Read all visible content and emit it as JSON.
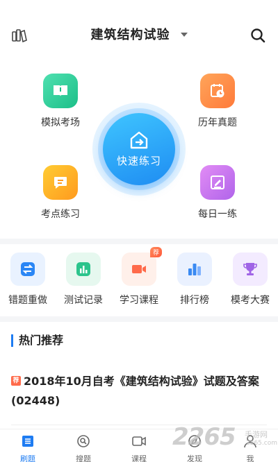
{
  "header": {
    "title": "建筑结构试验",
    "left_icon": "book-stack-icon",
    "right_icon": "search-icon"
  },
  "hub": {
    "center": {
      "label": "快速练习",
      "icon": "arrow-right-house-icon"
    },
    "items": [
      {
        "label": "模拟考场",
        "icon": "book-open-icon",
        "color": "#1cbf88"
      },
      {
        "label": "历年真题",
        "icon": "calendar-clock-icon",
        "color": "#ff7a3a"
      },
      {
        "label": "考点练习",
        "icon": "chat-lines-icon",
        "color": "#ff9a1e"
      },
      {
        "label": "每日一练",
        "icon": "pen-icon",
        "color": "#b064ea"
      }
    ]
  },
  "tools": [
    {
      "label": "错题重做",
      "icon": "swap-arrows-icon",
      "color": "#1e7cf2"
    },
    {
      "label": "测试记录",
      "icon": "bar-chart-icon",
      "color": "#1cbf88"
    },
    {
      "label": "学习课程",
      "icon": "video-camera-icon",
      "color": "#ff6a4a",
      "badge": "荐"
    },
    {
      "label": "排行榜",
      "icon": "ranking-bars-icon",
      "color": "#3a8af2"
    },
    {
      "label": "模考大赛",
      "icon": "trophy-icon",
      "color": "#a064e6"
    }
  ],
  "recommend": {
    "title": "热门推荐",
    "tag": "荐",
    "article_title": "2018年10月自考《建筑结构试验》试题及答案(02448)"
  },
  "bottom_nav": [
    {
      "label": "刷题",
      "icon": "grid-list-icon",
      "active": true
    },
    {
      "label": "搜题",
      "icon": "search-circle-icon",
      "active": false
    },
    {
      "label": "课程",
      "icon": "video-icon",
      "active": false
    },
    {
      "label": "发现",
      "icon": "compass-icon",
      "active": false
    },
    {
      "label": "我",
      "icon": "user-icon",
      "active": false
    }
  ],
  "watermark": {
    "big": "2265",
    "small": "手游网",
    "url": "2265.com"
  }
}
